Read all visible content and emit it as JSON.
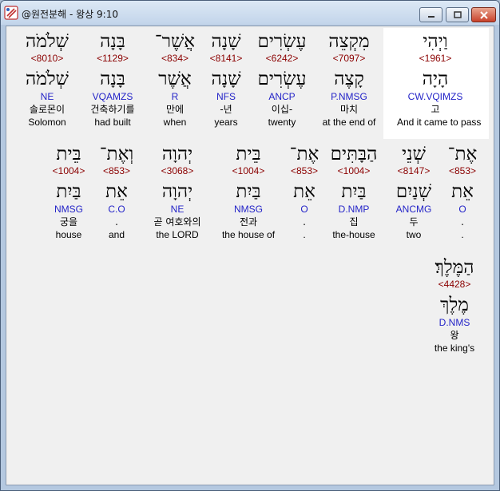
{
  "window": {
    "title": "@원전분해 - 왕상 9:10"
  },
  "colors": {
    "strong": "#8b0000",
    "parse": "#2424c8",
    "selected_bg": "#ffffff"
  },
  "words": [
    {
      "heb": "וַיְהִי",
      "strong": "<1961>",
      "lemma": "הָיָה",
      "parse": "CW.VQIMZS",
      "kor": "고",
      "eng": "And it came to pass"
    },
    {
      "heb": "מִקְצֵה",
      "strong": "<7097>",
      "lemma": "קָצֶה",
      "parse": "P.NMSG",
      "kor": "마치",
      "eng": "at the end of"
    },
    {
      "heb": "עֶשְׂרִים",
      "strong": "<6242>",
      "lemma": "עֶשְׂרִים",
      "parse": "ANCP",
      "kor": "이십-",
      "eng": "twenty"
    },
    {
      "heb": "שָׁנָה",
      "strong": "<8141>",
      "lemma": "שָׁנָה",
      "parse": "NFS",
      "kor": "-년",
      "eng": "years"
    },
    {
      "heb": "אֲשֶׁר־",
      "strong": "<834>",
      "lemma": "אֲשֶׁר",
      "parse": "R",
      "kor": "만에",
      "eng": "when"
    },
    {
      "heb": "בָּנָה",
      "strong": "<1129>",
      "lemma": "בָּנָה",
      "parse": "VQAMZS",
      "kor": "건축하기를",
      "eng": "had built"
    },
    {
      "heb": "שְׁלֹמֹה",
      "strong": "<8010>",
      "lemma": "שְׁלֹמֹה",
      "parse": "NE",
      "kor": "솔로몬이",
      "eng": "Solomon"
    },
    {
      "heb": "אֶת־",
      "strong": "<853>",
      "lemma": "אֵת",
      "parse": "O",
      "kor": ".",
      "eng": "."
    },
    {
      "heb": "שְׁנֵי",
      "strong": "<8147>",
      "lemma": "שְׁנַיִם",
      "parse": "ANCMG",
      "kor": "두",
      "eng": "two"
    },
    {
      "heb": "הַבָּתִּים",
      "strong": "<1004>",
      "lemma": "בַּיִת",
      "parse": "D.NMP",
      "kor": "집",
      "eng": "the-house"
    },
    {
      "heb": "אֶת־",
      "strong": "<853>",
      "lemma": "אֵת",
      "parse": "O",
      "kor": ".",
      "eng": "."
    },
    {
      "heb": "בֵּית",
      "strong": "<1004>",
      "lemma": "בַּיִת",
      "parse": "NMSG",
      "kor": "전과",
      "eng": "the house of"
    },
    {
      "heb": "יְהוָה",
      "strong": "<3068>",
      "lemma": "יְהוָה",
      "parse": "NE",
      "kor": "곧 여호와의",
      "eng": "the LORD"
    },
    {
      "heb": "וְאֶת־",
      "strong": "<853>",
      "lemma": "אֵת",
      "parse": "C.O",
      "kor": ".",
      "eng": "and"
    },
    {
      "heb": "בֵּית",
      "strong": "<1004>",
      "lemma": "בַּיִת",
      "parse": "NMSG",
      "kor": "궁을",
      "eng": "house"
    },
    {
      "heb": "הַמֶּלֶךְ׃",
      "strong": "<4428>",
      "lemma": "מֶלֶךְ",
      "parse": "D.NMS",
      "kor": "왕",
      "eng": "the king's"
    }
  ]
}
